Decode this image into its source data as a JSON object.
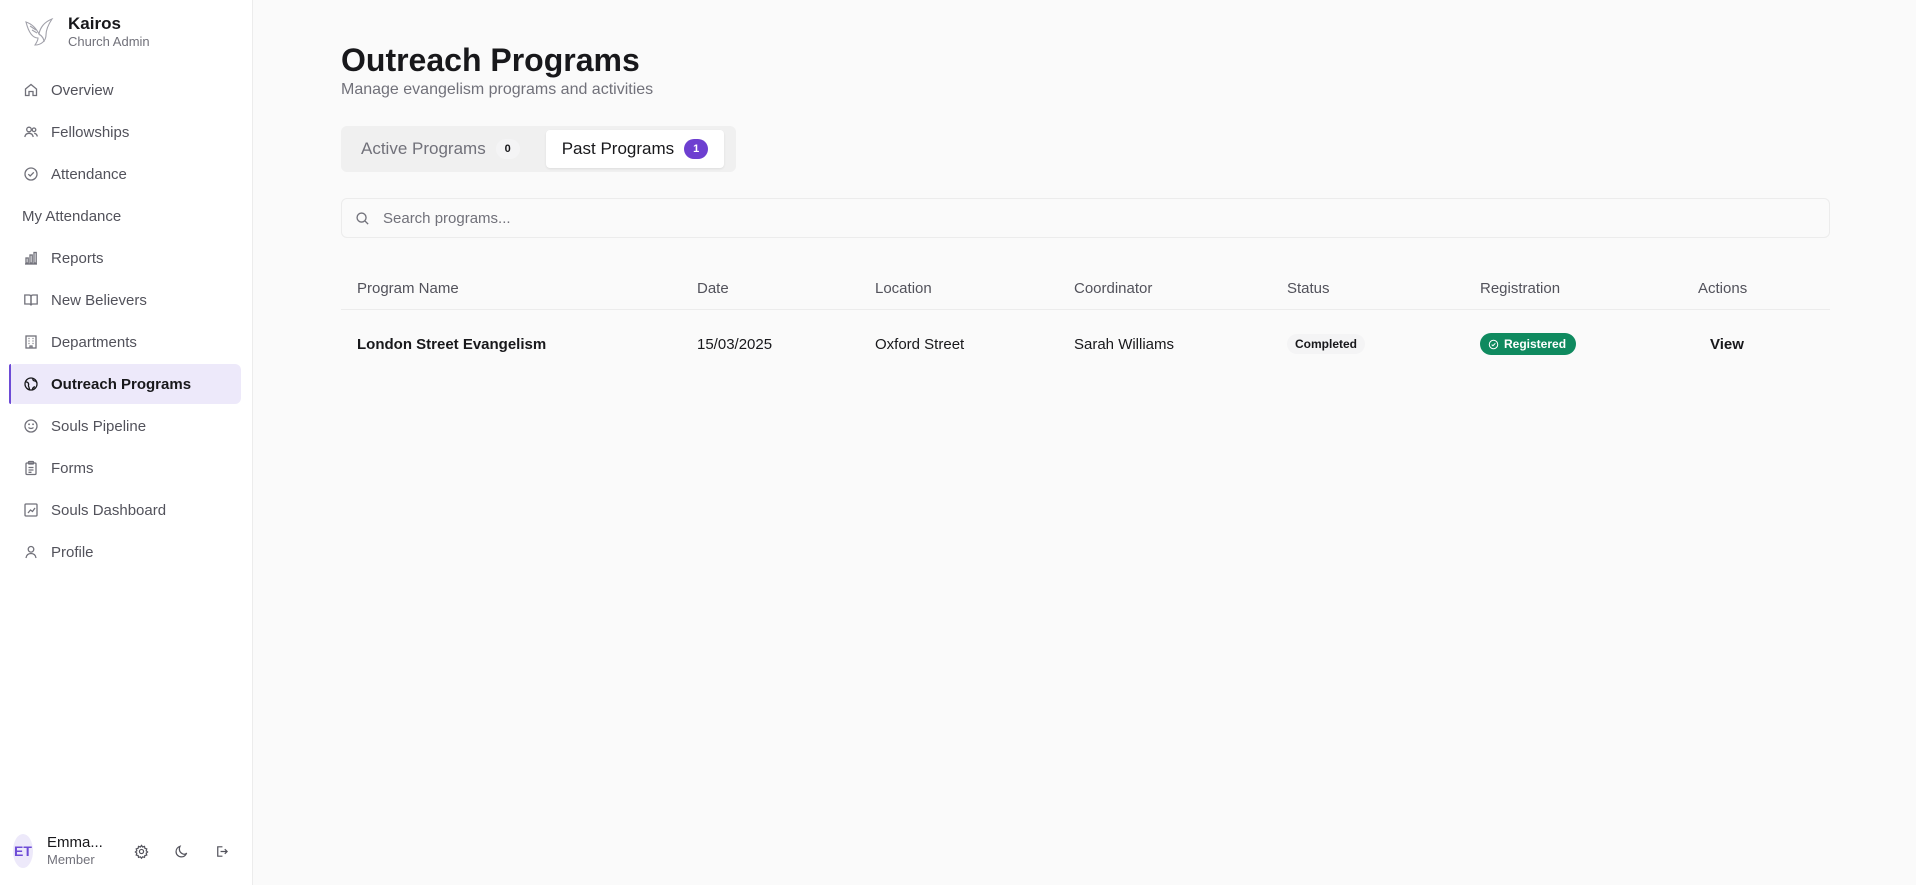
{
  "brand": {
    "name": "Kairos",
    "subtitle": "Church Admin"
  },
  "sidebar": {
    "items": [
      {
        "label": "Overview",
        "icon": "home-icon"
      },
      {
        "label": "Fellowships",
        "icon": "users-icon"
      },
      {
        "label": "Attendance",
        "icon": "check-circle-icon"
      },
      {
        "label": "My Attendance",
        "icon": ""
      },
      {
        "label": "Reports",
        "icon": "bar-chart-icon"
      },
      {
        "label": "New Believers",
        "icon": "book-open-icon"
      },
      {
        "label": "Departments",
        "icon": "building-icon"
      },
      {
        "label": "Outreach Programs",
        "icon": "globe-icon",
        "active": true
      },
      {
        "label": "Souls Pipeline",
        "icon": "smile-icon"
      },
      {
        "label": "Forms",
        "icon": "clipboard-icon"
      },
      {
        "label": "Souls Dashboard",
        "icon": "chart-square-icon"
      },
      {
        "label": "Profile",
        "icon": "user-icon"
      }
    ]
  },
  "user": {
    "initials": "ET",
    "name": "Emma...",
    "role": "Member"
  },
  "page": {
    "title": "Outreach Programs",
    "subtitle": "Manage evangelism programs and activities"
  },
  "tabs": [
    {
      "label": "Active Programs",
      "count": "0",
      "active": false
    },
    {
      "label": "Past Programs",
      "count": "1",
      "active": true
    }
  ],
  "search": {
    "placeholder": "Search programs..."
  },
  "table": {
    "columns": [
      "Program Name",
      "Date",
      "Location",
      "Coordinator",
      "Status",
      "Registration",
      "Actions"
    ],
    "rows": [
      {
        "name": "London Street Evangelism",
        "date": "15/03/2025",
        "location": "Oxford Street",
        "coordinator": "Sarah Williams",
        "status": "Completed",
        "registration": "Registered",
        "action": "View"
      }
    ]
  },
  "colors": {
    "accent": "#6d4bd6",
    "success": "#0f8a5f",
    "active_bg": "#ede9fa"
  }
}
